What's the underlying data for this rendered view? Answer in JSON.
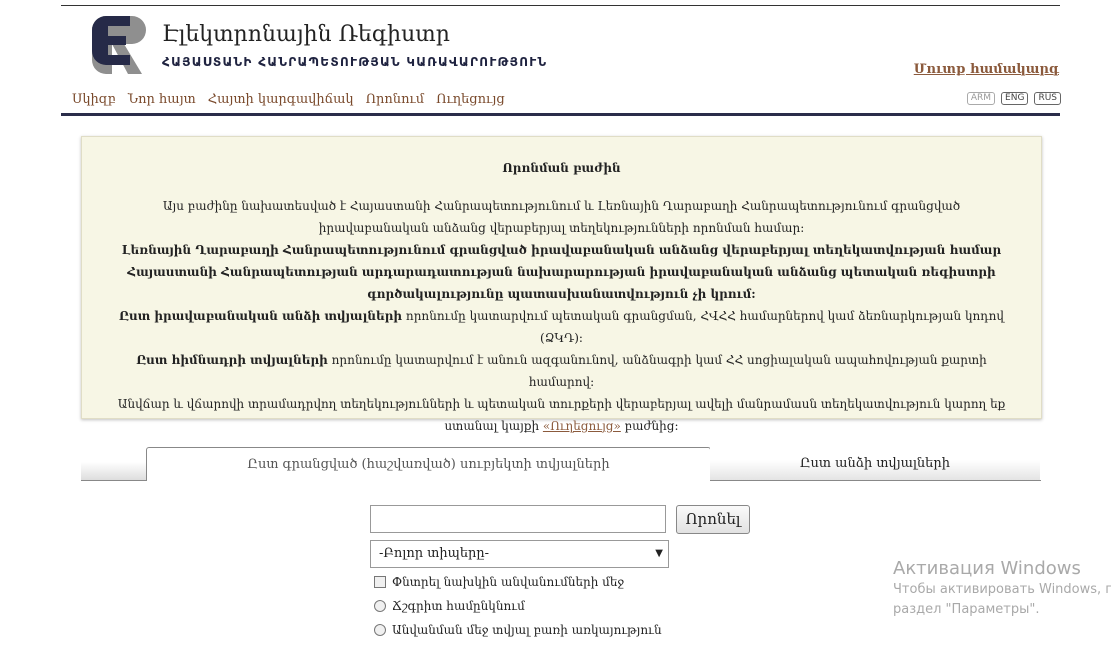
{
  "header": {
    "title": "Էլեկտրոնային Ռեգիստր",
    "subtitle": "ՀԱՅԱՍՏԱՆԻ ՀԱՆՐԱՊԵՏՈՒԹՅԱՆ ԿԱՌԱՎԱՐՈՒԹՅՈՒՆ",
    "login": "Մուտք համակարգ"
  },
  "nav": [
    "Սկիզբ",
    "Նոր հայտ",
    "Հայտի կարգավիճակ",
    "Որոնում",
    "Ուղեցույց"
  ],
  "languages": [
    "ARM",
    "ENG",
    "RUS"
  ],
  "info": {
    "title": "Որոնման բաժին",
    "p1": "Այս բաժինը նախատեսված է Հայաստանի Հանրապետությունում և Լեռնային Ղարաբաղի Հանրապետությունում գրանցված իրավաբանական անձանց վերաբերյալ տեղեկությունների որոնման համար:",
    "p2": "Լեռնային Ղարաբաղի Հանրապետությունում գրանցված իրավաբանական անձանց վերաբերյալ տեղեկատվության համար Հայաստանի Հանրապետության արդարադատության նախարարության իրավաբանական անձանց պետական ռեգիստրի գործակալությունը պատասխանատվություն չի կրում:",
    "p3_bold": "Ըստ իրավաբանական անձի տվյալների",
    "p3_rest": " որոնումը կատարվում պետական գրանցման, ՀՎՀՀ համարներով կամ ձեռնարկության կոդով (ՁԿԴ):",
    "p4_bold": "Ըստ հիմնադրի տվյալների",
    "p4_rest": " որոնումը կատարվում է անուն ազգանունով, անձնագրի կամ ՀՀ սոցիալական ապահովության քարտի համարով:",
    "p5_a": "Անվճար և վճարովի տրամադրվող տեղեկությունների և պետական տուրքերի վերաբերյալ ավելի մանրամասն տեղեկատվություն կարող եք ստանալ կայքի ",
    "p5_link": "«Ուղեցույց»",
    "p5_b": " բաժնից:"
  },
  "tabs": {
    "active": "Ըստ գրանցված (հաշվառված) սուբյեկտի տվյալների",
    "inactive": "Ըստ անձի տվյալների"
  },
  "search": {
    "value": "",
    "button": "Որոնել",
    "select_value": "-Բոլոր տիպերը-",
    "check1": "Փնտրել նախկին անվանումների մեջ",
    "radio1": "Ճշգրիտ համընկնում",
    "radio2": "Անվանման մեջ տվյալ բառի առկայություն"
  },
  "watermark": {
    "title": "Активация Windows",
    "line1": "Чтобы активировать Windows, п",
    "line2": "раздел \"Параметры\"."
  }
}
